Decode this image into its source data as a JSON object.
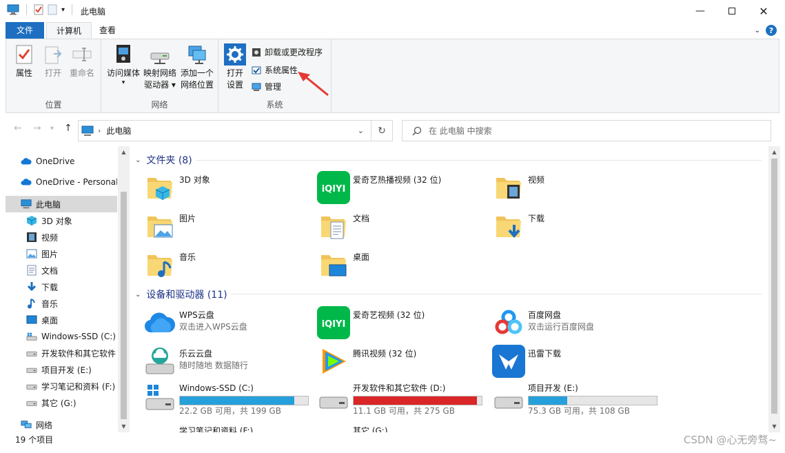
{
  "window": {
    "title": "此电脑",
    "controls": [
      "minimize-icon",
      "maximize-icon",
      "close-icon"
    ]
  },
  "ribbon": {
    "tabs": [
      {
        "label": "文件",
        "state": "file"
      },
      {
        "label": "计算机",
        "state": "active"
      },
      {
        "label": "查看",
        "state": "inactive"
      }
    ],
    "groups": {
      "location": {
        "label": "位置",
        "buttons": [
          {
            "label": "属性",
            "icon": "properties-icon",
            "enabled": true
          },
          {
            "label": "打开",
            "icon": "open-icon",
            "enabled": false
          },
          {
            "label": "重命名",
            "icon": "rename-icon",
            "enabled": false
          }
        ]
      },
      "network": {
        "label": "网络",
        "buttons": [
          {
            "label_line1": "访问媒体",
            "label_line2": "▾",
            "icon": "media-icon"
          },
          {
            "label_line1": "映射网络",
            "label_line2": "驱动器 ▾",
            "icon": "map-drive-icon"
          },
          {
            "label_line1": "添加一个",
            "label_line2": "网络位置",
            "icon": "network-location-icon"
          }
        ]
      },
      "system": {
        "label": "系统",
        "big": {
          "label_line1": "打开",
          "label_line2": "设置",
          "icon": "settings-gear-icon"
        },
        "small": [
          {
            "label": "卸载或更改程序",
            "icon": "uninstall-icon"
          },
          {
            "label": "系统属性",
            "icon": "system-properties-icon"
          },
          {
            "label": "管理",
            "icon": "manage-icon"
          }
        ]
      }
    }
  },
  "address": {
    "path": "此电脑",
    "search_placeholder": "在 此电脑 中搜索"
  },
  "nav": {
    "items": [
      {
        "label": "OneDrive",
        "icon": "cloud-icon",
        "level": 1
      },
      {
        "label": "OneDrive - Personal",
        "icon": "cloud-icon",
        "level": 1
      },
      {
        "label": "此电脑",
        "icon": "computer-icon",
        "level": 1,
        "selected": true
      },
      {
        "label": "3D 对象",
        "icon": "cube-icon",
        "level": 2
      },
      {
        "label": "视频",
        "icon": "video-icon",
        "level": 2
      },
      {
        "label": "图片",
        "icon": "picture-icon",
        "level": 2
      },
      {
        "label": "文档",
        "icon": "document-icon",
        "level": 2
      },
      {
        "label": "下载",
        "icon": "download-icon",
        "level": 2
      },
      {
        "label": "音乐",
        "icon": "music-icon",
        "level": 2
      },
      {
        "label": "桌面",
        "icon": "desktop-icon",
        "level": 2
      },
      {
        "label": "Windows-SSD (C:)",
        "icon": "system-drive-icon",
        "level": 2
      },
      {
        "label": "开发软件和其它软件",
        "icon": "drive-icon",
        "level": 2
      },
      {
        "label": "项目开发 (E:)",
        "icon": "drive-icon",
        "level": 2
      },
      {
        "label": "学习笔记和资料 (F:)",
        "icon": "drive-icon",
        "level": 2
      },
      {
        "label": "其它 (G:)",
        "icon": "drive-icon",
        "level": 2
      },
      {
        "label": "网络",
        "icon": "network-icon",
        "level": 1
      }
    ]
  },
  "content": {
    "folders_header": "文件夹 (8)",
    "folders": [
      {
        "name": "3D 对象",
        "icon": "folder-3d-icon"
      },
      {
        "name": "爱奇艺热播视频 (32 位)",
        "icon": "iqiyi-icon"
      },
      {
        "name": "视频",
        "icon": "folder-video-icon"
      },
      {
        "name": "图片",
        "icon": "folder-pictures-icon"
      },
      {
        "name": "文档",
        "icon": "folder-documents-icon"
      },
      {
        "name": "下载",
        "icon": "folder-downloads-icon"
      },
      {
        "name": "音乐",
        "icon": "folder-music-icon"
      },
      {
        "name": "桌面",
        "icon": "folder-desktop-icon"
      }
    ],
    "devices_header": "设备和驱动器 (11)",
    "apps": [
      {
        "name": "WPS云盘",
        "sub": "双击进入WPS云盘",
        "icon": "wps-cloud-icon"
      },
      {
        "name": "爱奇艺视频 (32 位)",
        "sub": "",
        "icon": "iqiyi-icon"
      },
      {
        "name": "百度网盘",
        "sub": "双击运行百度网盘",
        "icon": "baidu-netdisk-icon"
      },
      {
        "name": "乐云云盘",
        "sub": "随时随地 数据随行",
        "icon": "leyun-icon"
      },
      {
        "name": "腾讯视频 (32 位)",
        "sub": "",
        "icon": "tencent-video-icon"
      },
      {
        "name": "迅雷下载",
        "sub": "",
        "icon": "xunlei-icon"
      }
    ],
    "drives": [
      {
        "name": "Windows-SSD (C:)",
        "usage": "22.2 GB 可用，共 199 GB",
        "used_fraction": 0.89,
        "critical": false,
        "icon": "system-drive-icon"
      },
      {
        "name": "开发软件和其它软件 (D:)",
        "usage": "11.1 GB 可用，共 275 GB",
        "used_fraction": 0.96,
        "critical": true,
        "icon": "drive-icon"
      },
      {
        "name": "项目开发 (E:)",
        "usage": "75.3 GB 可用，共 108 GB",
        "used_fraction": 0.3,
        "critical": false,
        "icon": "drive-icon"
      }
    ],
    "partial_drives": [
      "学习笔记和资料 (F:)",
      "其它 (G:)"
    ]
  },
  "status": {
    "count": "19 个项目"
  },
  "watermark": "CSDN @心无旁骛~",
  "colors": {
    "accent": "#1e6fc1",
    "drive_bar": "#26a0da",
    "drive_bar_critical": "#da2626",
    "section_heading": "#1e3287",
    "annotation": "#e53935"
  }
}
